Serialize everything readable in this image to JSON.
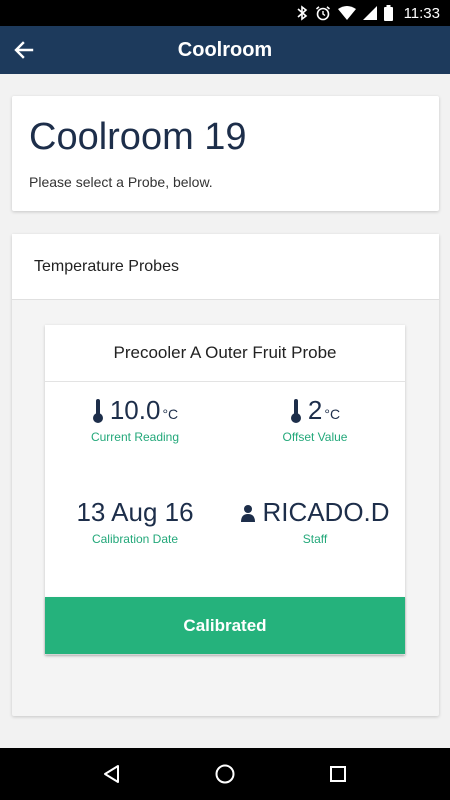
{
  "status_bar": {
    "time": "11:33",
    "icons": [
      "bluetooth-icon",
      "alarm-icon",
      "wifi-icon",
      "signal-icon",
      "battery-icon"
    ]
  },
  "app_bar": {
    "title": "Coolroom",
    "back_icon": "arrow-left-icon"
  },
  "header": {
    "title": "Coolroom 19",
    "subtitle": "Please select a Probe, below."
  },
  "probes_section": {
    "title": "Temperature Probes",
    "probe": {
      "name": "Precooler A Outer Fruit Probe",
      "current_reading": {
        "value": "10.0",
        "unit": "°C",
        "label": "Current Reading",
        "icon": "thermometer-icon"
      },
      "offset_value": {
        "value": "2",
        "unit": "°C",
        "label": "Offset Value",
        "icon": "thermometer-icon"
      },
      "calibration_date": {
        "value": "13 Aug 16",
        "label": "Calibration Date"
      },
      "staff": {
        "value": "RICADO.D",
        "label": "Staff",
        "icon": "person-icon"
      },
      "button_label": "Calibrated"
    }
  },
  "colors": {
    "app_bar": "#1d3a5c",
    "accent_green": "#25b27c",
    "heading_navy": "#1d2e4a"
  },
  "nav_bar": {
    "icons": [
      "back-triangle-icon",
      "home-circle-icon",
      "recents-square-icon"
    ]
  }
}
